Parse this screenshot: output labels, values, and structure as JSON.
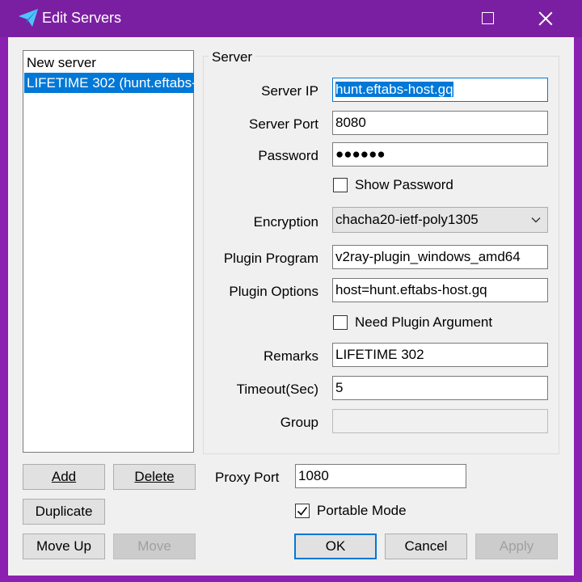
{
  "window": {
    "title": "Edit Servers",
    "accent": "#7b1fa2",
    "icons": {
      "app": "paper-plane-icon",
      "maximize": "maximize-icon",
      "close": "close-icon"
    }
  },
  "server_list": {
    "items": [
      {
        "label": "New server",
        "selected": false
      },
      {
        "label": "LIFETIME 302 (hunt.eftabs-",
        "selected": true
      }
    ]
  },
  "server_group": {
    "title": "Server",
    "fields": {
      "server_ip": {
        "label": "Server IP",
        "value": "hunt.eftabs-host.gq"
      },
      "server_port": {
        "label": "Server Port",
        "value": "8080"
      },
      "password": {
        "label": "Password",
        "value": "●●●●●●"
      },
      "show_password": {
        "label": "Show Password",
        "checked": false
      },
      "encryption": {
        "label": "Encryption",
        "value": "chacha20-ietf-poly1305"
      },
      "plugin_program": {
        "label": "Plugin Program",
        "value": "v2ray-plugin_windows_amd64"
      },
      "plugin_options": {
        "label": "Plugin Options",
        "value": "host=hunt.eftabs-host.gq"
      },
      "need_plugin_argument": {
        "label": "Need Plugin Argument",
        "checked": false
      },
      "remarks": {
        "label": "Remarks",
        "value": "LIFETIME 302"
      },
      "timeout": {
        "label": "Timeout(Sec)",
        "value": "5"
      },
      "group": {
        "label": "Group",
        "value": ""
      }
    }
  },
  "list_buttons": {
    "add": "Add",
    "delete": "Delete",
    "duplicate": "Duplicate",
    "move_up": "Move Up",
    "move_down": "Move"
  },
  "proxy": {
    "label": "Proxy Port",
    "value": "1080"
  },
  "portable_mode": {
    "label": "Portable Mode",
    "checked": true
  },
  "dialog_buttons": {
    "ok": "OK",
    "cancel": "Cancel",
    "apply": "Apply"
  }
}
